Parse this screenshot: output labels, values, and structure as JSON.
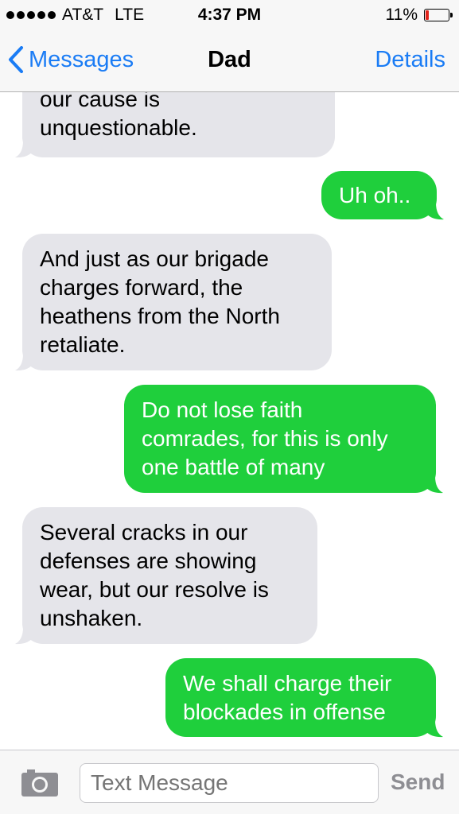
{
  "status_bar": {
    "carrier": "AT&T",
    "network": "LTE",
    "time": "4:37 PM",
    "battery": "11%",
    "battery_level": 0.11
  },
  "nav": {
    "back_label": "Messages",
    "title": "Dad",
    "details_label": "Details"
  },
  "messages": [
    {
      "type": "received",
      "lines": [
        "our cause is",
        "unquestionable."
      ]
    },
    {
      "type": "sent",
      "lines": [
        "Uh oh.."
      ]
    },
    {
      "type": "received",
      "lines": [
        "And just as our brigade",
        "charges forward, the",
        "heathens from the North",
        "retaliate."
      ]
    },
    {
      "type": "sent",
      "lines": [
        "Do not lose faith",
        "comrades, for this is only",
        "one battle of many"
      ]
    },
    {
      "type": "received",
      "lines": [
        "Several cracks in our",
        "defenses are showing",
        "wear, but our resolve is",
        "unshaken."
      ]
    },
    {
      "type": "sent",
      "lines": [
        "We shall charge their",
        "blockades in offense"
      ]
    }
  ],
  "composer": {
    "placeholder": "Text Message",
    "send_label": "Send"
  },
  "colors": {
    "accent": "#1a7cf5",
    "sent_bubble": "#1fcf3c",
    "received_bubble": "#e5e5ea"
  }
}
